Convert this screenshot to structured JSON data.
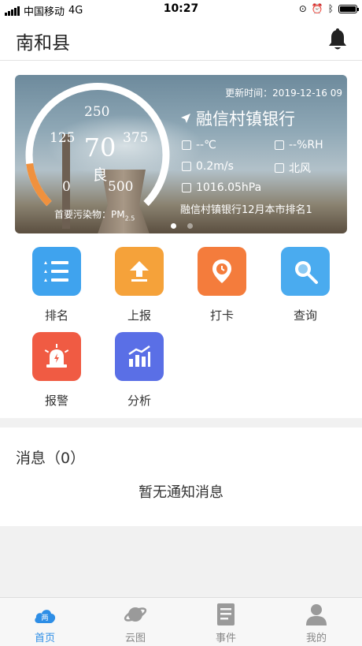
{
  "status_bar": {
    "carrier": "中国移动",
    "network": "4G",
    "time": "10:27"
  },
  "header": {
    "title": "南和县"
  },
  "banner": {
    "updated": "更新时间：2019-12-16 09",
    "station": "融信村镇银行",
    "aqi_value": "70",
    "aqi_level": "良",
    "gauge_level_percent": 14,
    "scale": [
      "0",
      "125",
      "250",
      "375",
      "500"
    ],
    "pollutant_label": "首要污染物：PM",
    "pollutant_sub": "2.5",
    "temperature": "--℃",
    "humidity": "--%RH",
    "wind_speed": "0.2m/s",
    "wind_direction": "北风",
    "pressure": "1016.05hPa",
    "rank_text": "融信村镇银行12月本市排名1"
  },
  "features": [
    {
      "label": "排名",
      "icon": "ranking-list-icon",
      "color": "#3fa3ee"
    },
    {
      "label": "上报",
      "icon": "upload-arrow-icon",
      "color": "#f5a23a"
    },
    {
      "label": "打卡",
      "icon": "location-clock-icon",
      "color": "#f47c3c"
    },
    {
      "label": "查询",
      "icon": "search-icon",
      "color": "#4aabef"
    },
    {
      "label": "报警",
      "icon": "alarm-siren-icon",
      "color": "#f05b43"
    },
    {
      "label": "分析",
      "icon": "chart-analysis-icon",
      "color": "#5a6fe6"
    }
  ],
  "messages": {
    "title": "消息（0）",
    "empty_text": "暂无通知消息"
  },
  "tabs": [
    {
      "label": "首页",
      "icon": "home-cloud-icon",
      "active": true
    },
    {
      "label": "云图",
      "icon": "planet-icon",
      "active": false
    },
    {
      "label": "事件",
      "icon": "document-icon",
      "active": false
    },
    {
      "label": "我的",
      "icon": "person-icon",
      "active": false
    }
  ],
  "colors": {
    "accent": "#2e8ee6",
    "gauge_fill": "#f0913e"
  }
}
